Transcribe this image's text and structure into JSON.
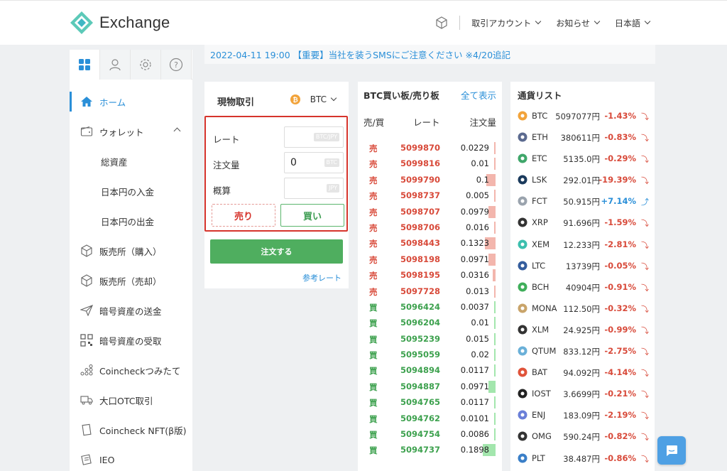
{
  "brand": {
    "name": "Exchange",
    "accent": "#2a8fd8"
  },
  "topnav": {
    "cube_icon": "cube-icon",
    "menus": [
      {
        "label": "取引アカウント"
      },
      {
        "label": "お知らせ"
      },
      {
        "label": "日本語"
      }
    ]
  },
  "sidebar": {
    "tabs": [
      "grid-icon",
      "user-icon",
      "gear-icon",
      "help-icon"
    ],
    "items": [
      {
        "label": "ホーム",
        "icon": "home-icon"
      },
      {
        "label": "ウォレット",
        "icon": "wallet-icon"
      },
      {
        "label": "総資産"
      },
      {
        "label": "日本円の入金"
      },
      {
        "label": "日本円の出金"
      },
      {
        "label": "販売所（購入）",
        "icon": "cube-icon"
      },
      {
        "label": "販売所（売却）",
        "icon": "cube-icon"
      },
      {
        "label": "暗号資産の送金",
        "icon": "send-icon"
      },
      {
        "label": "暗号資産の受取",
        "icon": "qr-icon"
      },
      {
        "label": "Coincheckつみたて",
        "icon": "coins-icon"
      },
      {
        "label": "大口OTC取引",
        "icon": "truck-icon"
      },
      {
        "label": "Coincheck NFT(β版)",
        "icon": "nft-icon"
      },
      {
        "label": "IEO",
        "icon": "ieo-icon"
      }
    ]
  },
  "notice": {
    "text": "2022-04-11 19:00 【重要】当社を装うSMSにご注意ください ※4/20追記"
  },
  "trade": {
    "title": "現物取引",
    "coin": "BTC",
    "rate_label": "レート",
    "rate_unit": "BTC/JPY",
    "rate_value": "",
    "amount_label": "注文量",
    "amount_value": "0",
    "amount_unit": "BTC",
    "estimate_label": "概算",
    "estimate_unit": "JPY",
    "sell_label": "売り",
    "buy_label": "買い",
    "order_label": "注文する",
    "ref_rate": "参考レート"
  },
  "orderbook": {
    "title": "BTC買い板/売り板",
    "show_all": "全て表示",
    "col_side": "売/買",
    "col_rate": "レート",
    "col_amount": "注文量",
    "rows": [
      {
        "side": "売",
        "type": "sell",
        "rate": "5099870",
        "amount": "0.0229",
        "depth": 0.1
      },
      {
        "side": "売",
        "type": "sell",
        "rate": "5099816",
        "amount": "0.01",
        "depth": 0.05
      },
      {
        "side": "売",
        "type": "sell",
        "rate": "5099790",
        "amount": "0.1",
        "depth": 0.7
      },
      {
        "side": "売",
        "type": "sell",
        "rate": "5098737",
        "amount": "0.005",
        "depth": 0.03
      },
      {
        "side": "売",
        "type": "sell",
        "rate": "5098707",
        "amount": "0.0979",
        "depth": 0.55
      },
      {
        "side": "売",
        "type": "sell",
        "rate": "5098706",
        "amount": "0.016",
        "depth": 0.1
      },
      {
        "side": "売",
        "type": "sell",
        "rate": "5098443",
        "amount": "0.1323",
        "depth": 0.85
      },
      {
        "side": "売",
        "type": "sell",
        "rate": "5098198",
        "amount": "0.0971",
        "depth": 0.55
      },
      {
        "side": "売",
        "type": "sell",
        "rate": "5098195",
        "amount": "0.0316",
        "depth": 0.2
      },
      {
        "side": "売",
        "type": "sell",
        "rate": "5097728",
        "amount": "0.013",
        "depth": 0.08
      },
      {
        "side": "買",
        "type": "buy",
        "rate": "5096424",
        "amount": "0.0037",
        "depth": 0.03
      },
      {
        "side": "買",
        "type": "buy",
        "rate": "5096204",
        "amount": "0.01",
        "depth": 0.05
      },
      {
        "side": "買",
        "type": "buy",
        "rate": "5095239",
        "amount": "0.015",
        "depth": 0.08
      },
      {
        "side": "買",
        "type": "buy",
        "rate": "5095059",
        "amount": "0.02",
        "depth": 0.1
      },
      {
        "side": "買",
        "type": "buy",
        "rate": "5094894",
        "amount": "0.0117",
        "depth": 0.07
      },
      {
        "side": "買",
        "type": "buy",
        "rate": "5094887",
        "amount": "0.0971",
        "depth": 0.55
      },
      {
        "side": "買",
        "type": "buy",
        "rate": "5094765",
        "amount": "0.0117",
        "depth": 0.07
      },
      {
        "side": "買",
        "type": "buy",
        "rate": "5094762",
        "amount": "0.0101",
        "depth": 0.06
      },
      {
        "side": "買",
        "type": "buy",
        "rate": "5094754",
        "amount": "0.0086",
        "depth": 0.05
      },
      {
        "side": "買",
        "type": "buy",
        "rate": "5094737",
        "amount": "0.1898",
        "depth": 1.0
      }
    ]
  },
  "coinlist": {
    "title": "通貨リスト",
    "rows": [
      {
        "sym": "BTC",
        "price": "5097077円",
        "change": "-1.43%",
        "dir": "down",
        "icon": "btc-icon",
        "color": "#f2a33a"
      },
      {
        "sym": "ETH",
        "price": "380611円",
        "change": "-0.83%",
        "dir": "down",
        "icon": "eth-icon",
        "color": "#5b6a8f"
      },
      {
        "sym": "ETC",
        "price": "5135.0円",
        "change": "-0.29%",
        "dir": "down",
        "icon": "etc-icon",
        "color": "#3fa66a"
      },
      {
        "sym": "LSK",
        "price": "292.01円",
        "change": "-19.39%",
        "dir": "down",
        "icon": "lsk-icon",
        "color": "#1a3a5c"
      },
      {
        "sym": "FCT",
        "price": "50.915円",
        "change": "+7.14%",
        "dir": "up",
        "icon": "fct-icon",
        "color": "#9aa3ad"
      },
      {
        "sym": "XRP",
        "price": "91.696円",
        "change": "-1.59%",
        "dir": "down",
        "icon": "xrp-icon",
        "color": "#333333"
      },
      {
        "sym": "XEM",
        "price": "12.233円",
        "change": "-2.81%",
        "dir": "down",
        "icon": "xem-icon",
        "color": "#3cbfae"
      },
      {
        "sym": "LTC",
        "price": "13739円",
        "change": "-0.05%",
        "dir": "down",
        "icon": "ltc-icon",
        "color": "#345d9d"
      },
      {
        "sym": "BCH",
        "price": "40904円",
        "change": "-0.91%",
        "dir": "down",
        "icon": "bch-icon",
        "color": "#3fae5a"
      },
      {
        "sym": "MONA",
        "price": "112.50円",
        "change": "-0.32%",
        "dir": "down",
        "icon": "mona-icon",
        "color": "#c9a46a"
      },
      {
        "sym": "XLM",
        "price": "24.925円",
        "change": "-0.99%",
        "dir": "down",
        "icon": "xlm-icon",
        "color": "#333333"
      },
      {
        "sym": "QTUM",
        "price": "833.12円",
        "change": "-2.75%",
        "dir": "down",
        "icon": "qtum-icon",
        "color": "#6ab0d8"
      },
      {
        "sym": "BAT",
        "price": "94.092円",
        "change": "-4.14%",
        "dir": "down",
        "icon": "bat-icon",
        "color": "#e0533a"
      },
      {
        "sym": "IOST",
        "price": "3.6699円",
        "change": "-0.21%",
        "dir": "down",
        "icon": "iost-icon",
        "color": "#222222"
      },
      {
        "sym": "ENJ",
        "price": "183.09円",
        "change": "-2.19%",
        "dir": "down",
        "icon": "enj-icon",
        "color": "#6a7fd8"
      },
      {
        "sym": "OMG",
        "price": "590.24円",
        "change": "-0.82%",
        "dir": "down",
        "icon": "omg-icon",
        "color": "#333333"
      },
      {
        "sym": "PLT",
        "price": "38.487円",
        "change": "-0.86%",
        "dir": "down",
        "icon": "plt-icon",
        "color": "#3a7fc8"
      }
    ]
  },
  "chat": {
    "icon": "chat-icon"
  }
}
